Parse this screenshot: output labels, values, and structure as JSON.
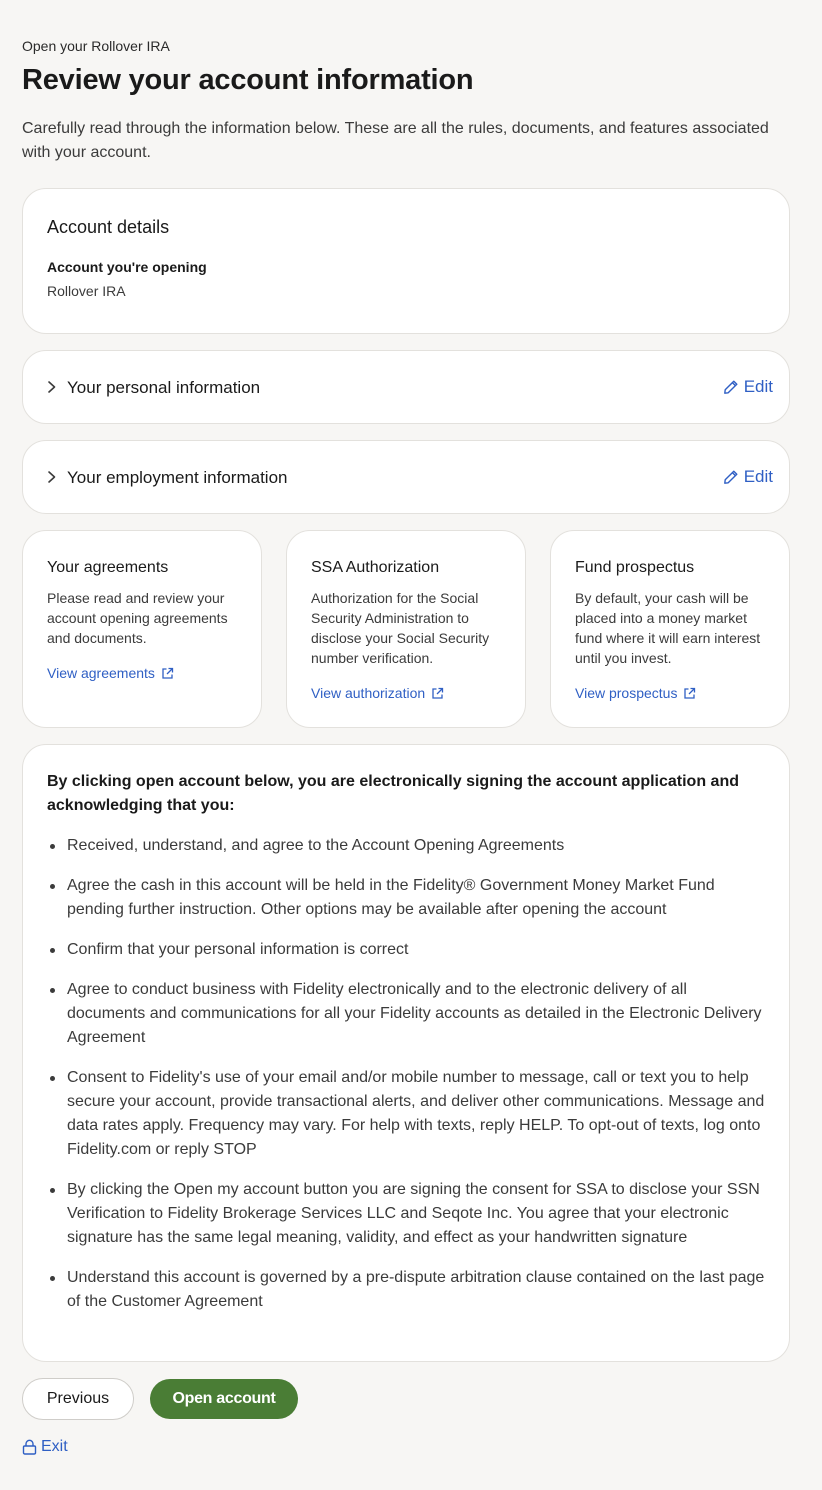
{
  "header": {
    "eyebrow": "Open your Rollover IRA",
    "title": "Review your account information",
    "intro": "Carefully read through the information below. These are all the rules, documents, and features associated with your account."
  },
  "account_details": {
    "heading": "Account details",
    "label": "Account you're opening",
    "value": "Rollover IRA"
  },
  "sections": [
    {
      "title": "Your personal information",
      "edit_label": "Edit"
    },
    {
      "title": "Your employment information",
      "edit_label": "Edit"
    }
  ],
  "info_cards": [
    {
      "title": "Your agreements",
      "body": "Please read and review your account opening agreements and documents.",
      "link": "View agreements"
    },
    {
      "title": "SSA Authorization",
      "body": "Authorization for the Social Security Administration to disclose your Social Security number verification.",
      "link": "View authorization"
    },
    {
      "title": "Fund prospectus",
      "body": "By default, your cash will be placed into a money market fund where it will earn interest until you invest.",
      "link": "View prospectus"
    }
  ],
  "terms": {
    "heading": "By clicking open account below, you are electronically signing the account application and acknowledging that you:",
    "items": [
      "Received, understand, and agree to the Account Opening Agreements",
      "Agree the cash in this account will be held in the Fidelity® Government Money Market Fund pending further instruction. Other options may be available after opening the account",
      "Confirm that your personal information is correct",
      "Agree to conduct business with Fidelity electronically and to the electronic delivery of all documents and communications for all your Fidelity accounts as detailed in the Electronic Delivery Agreement",
      "Consent to Fidelity's use of your email and/or mobile number to message, call or text you to help secure your account, provide transactional alerts, and deliver other communications. Message and data rates apply. Frequency may vary. For help with texts, reply HELP. To opt-out of texts, log onto Fidelity.com or reply STOP",
      "By clicking the Open my account button you are signing the consent for SSA to disclose your SSN Verification to Fidelity Brokerage Services LLC and Seqote Inc. You agree that your electronic signature has the same legal meaning, validity, and effect as your handwritten signature",
      "Understand this account is governed by a pre-dispute arbitration clause contained on the last page of the Customer Agreement"
    ]
  },
  "actions": {
    "previous": "Previous",
    "open": "Open account",
    "exit": "Exit"
  },
  "icons": {
    "chevron": "chevron-right-icon",
    "edit": "pencil-icon",
    "external": "external-link-icon",
    "exit": "lock-icon"
  },
  "colors": {
    "link": "#2f5fc4",
    "primary_button": "#4a7d35",
    "background": "#f7f6f4"
  }
}
